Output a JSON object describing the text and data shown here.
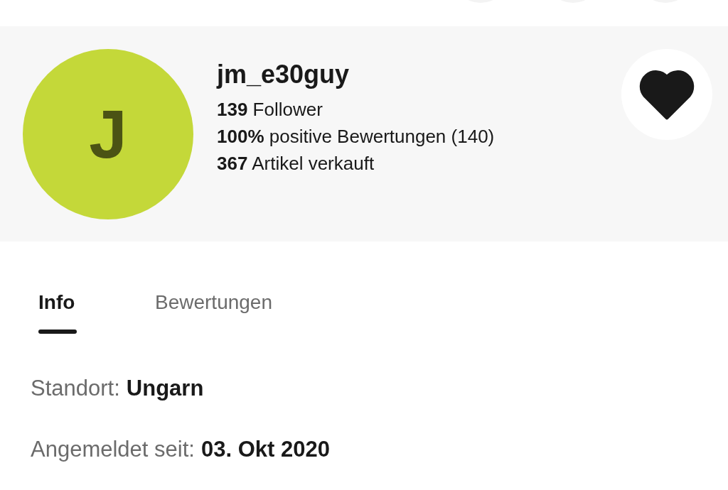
{
  "top_buttons": [
    {
      "kind": "round"
    },
    {
      "kind": "round"
    },
    {
      "kind": "round"
    }
  ],
  "profile": {
    "avatar_letter": "J",
    "username": "jm_e30guy",
    "stats": [
      "**139** Follower",
      "**100%** positive Bewertungen (140)",
      "**367** Artikel verkauft"
    ],
    "saved": true
  },
  "tabs": [
    {
      "label": "Info",
      "selected": true
    },
    {
      "label": "Bewertungen",
      "selected": false
    }
  ],
  "info": [
    {
      "label": "Standort:",
      "value": "Ungarn"
    },
    {
      "label": "Angemeldet seit:",
      "value": "03. Okt 2020"
    }
  ]
}
